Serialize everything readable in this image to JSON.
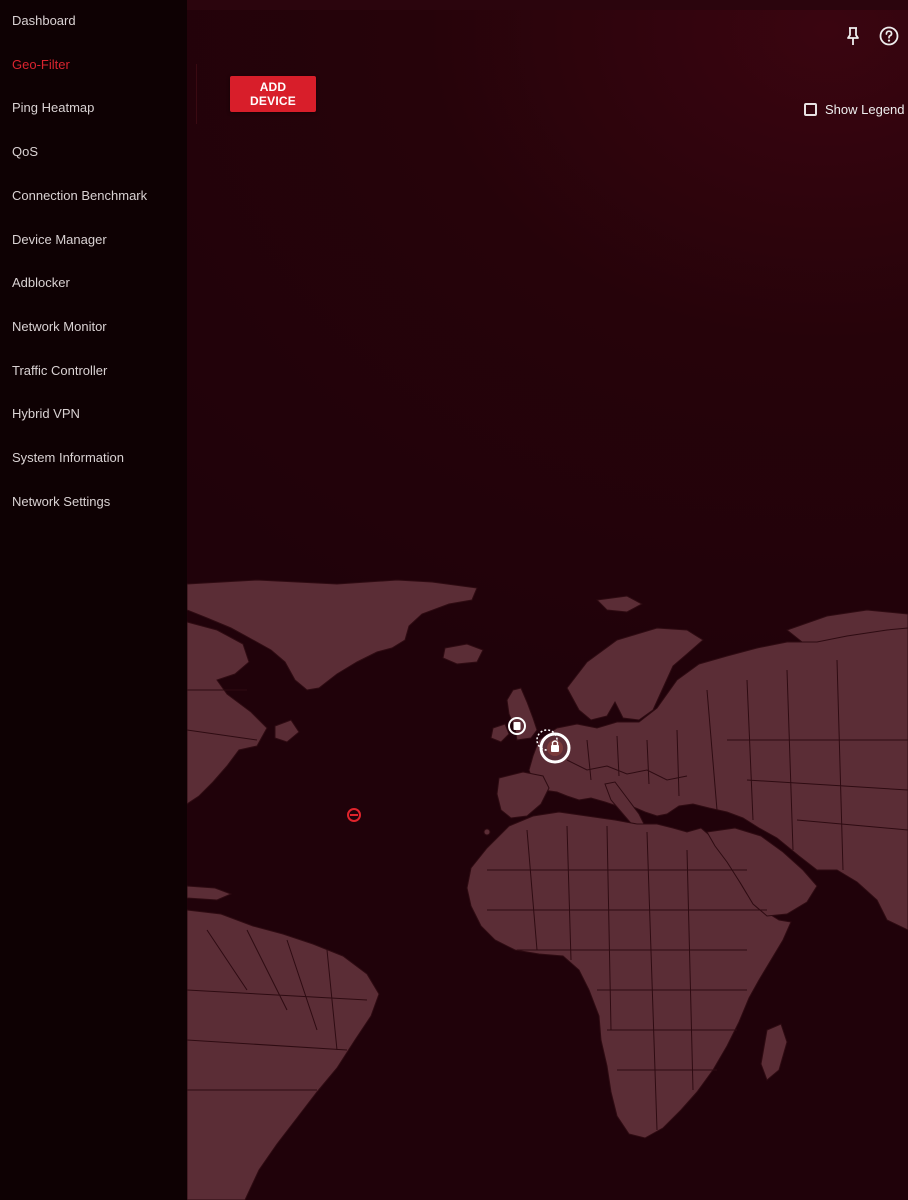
{
  "sidebar": {
    "items": [
      {
        "label": "Dashboard"
      },
      {
        "label": "Geo-Filter",
        "active": true
      },
      {
        "label": "Ping Heatmap"
      },
      {
        "label": "QoS"
      },
      {
        "label": "Connection Benchmark"
      },
      {
        "label": "Device Manager"
      },
      {
        "label": "Adblocker"
      },
      {
        "label": "Network Monitor"
      },
      {
        "label": "Traffic Controller"
      },
      {
        "label": "Hybrid VPN"
      },
      {
        "label": "System Information"
      },
      {
        "label": "Network Settings"
      }
    ]
  },
  "toolbar": {
    "add_device_label": "ADD DEVICE",
    "show_legend_label": "Show Legend",
    "show_legend_checked": false,
    "pin_icon": "pin-icon",
    "help_icon": "help-icon"
  },
  "colors": {
    "accent": "#d81e2a",
    "sidebar_bg": "#0e0103",
    "map_bg": "#26030a",
    "land": "#5b2d36"
  },
  "map": {
    "markers": [
      {
        "icon": "device-marker-icon"
      },
      {
        "icon": "home-location-marker-icon"
      },
      {
        "icon": "geo-filter-marker-icon"
      }
    ]
  }
}
